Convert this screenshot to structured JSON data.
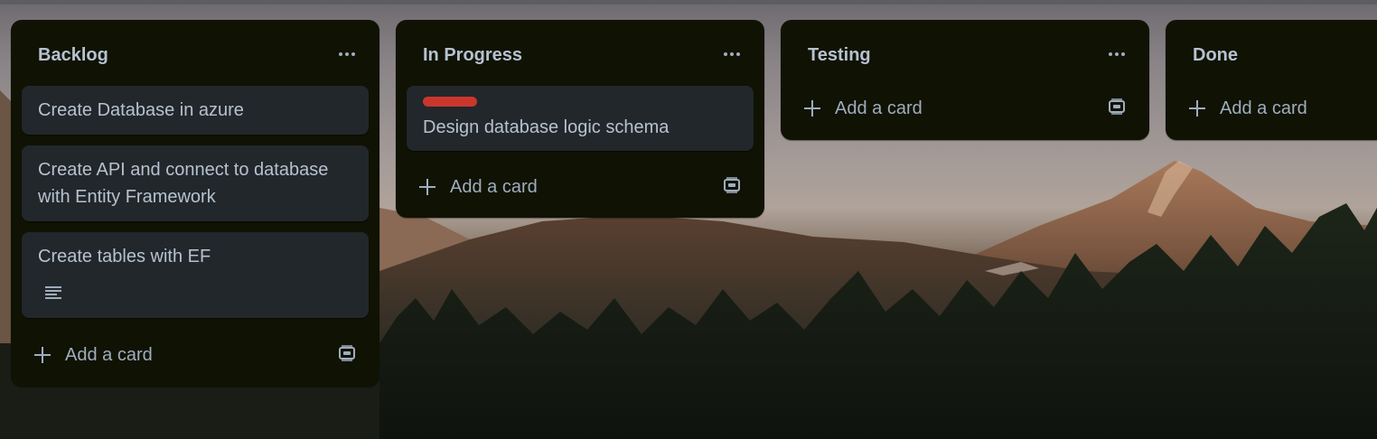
{
  "lists": [
    {
      "title": "Backlog",
      "cards": [
        {
          "text": "Create Database in azure"
        },
        {
          "text": "Create API and connect to database with Entity Framework"
        },
        {
          "text": "Create tables with EF",
          "has_description": true
        }
      ],
      "add_card_label": "Add a card"
    },
    {
      "title": "In Progress",
      "cards": [
        {
          "text": "Design database logic schema",
          "label_color": "#c9372c"
        }
      ],
      "add_card_label": "Add a card"
    },
    {
      "title": "Testing",
      "cards": [],
      "add_card_label": "Add a card"
    },
    {
      "title": "Done",
      "cards": [],
      "add_card_label": "Add a card"
    }
  ],
  "colors": {
    "list_background": "#101204",
    "card_background": "#22272b",
    "text": "#b6c2cf",
    "muted_text": "#9fadbc",
    "label_red": "#c9372c"
  },
  "icons": {
    "list_menu": "more-horizontal-icon",
    "add": "plus-icon",
    "template": "card-template-icon",
    "description": "description-lines-icon"
  }
}
